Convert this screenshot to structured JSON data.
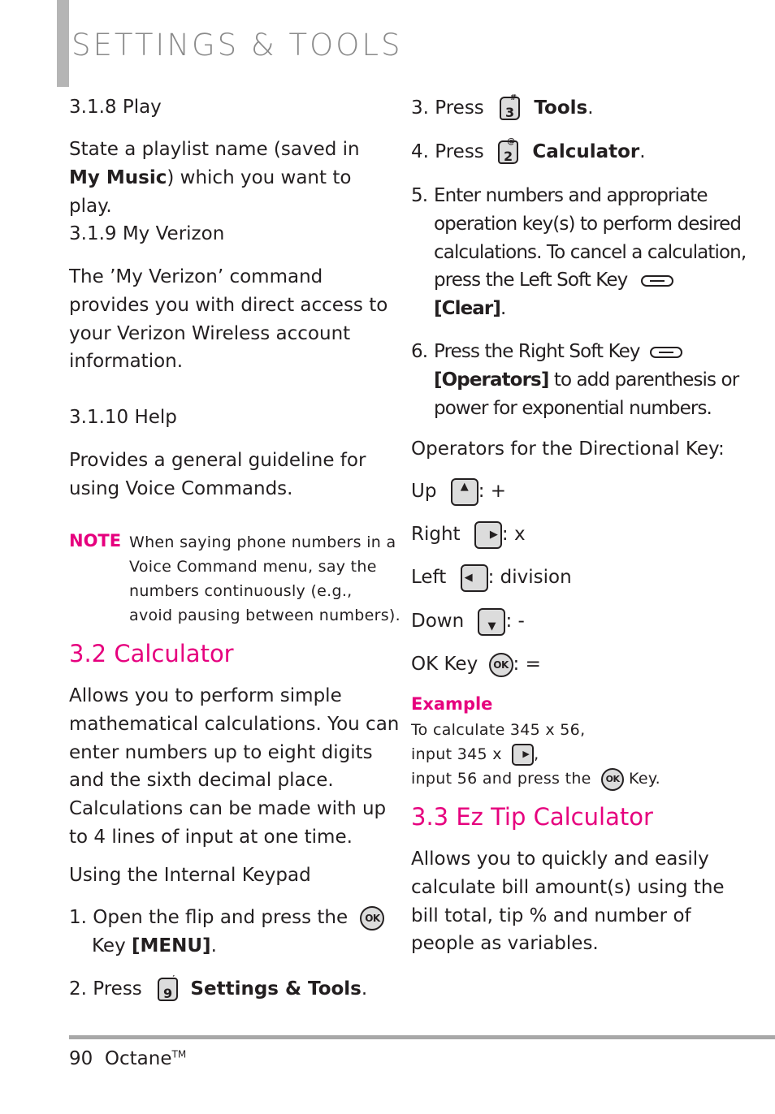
{
  "header": {
    "title": "SETTINGS & TOOLS"
  },
  "left": {
    "s318": {
      "heading": "3.1.8 Play",
      "text_pre": "State a playlist name (saved in ",
      "text_bold": "My Music",
      "text_post": ") which you want to play."
    },
    "s319": {
      "heading": "3.1.9 My Verizon",
      "lines": [
        "The ’My Verizon’ command",
        "provides you with direct access to",
        "your Verizon Wireless account",
        "information."
      ]
    },
    "s3110": {
      "heading": "3.1.10 Help",
      "lines": [
        "Provides a general guideline for",
        "using Voice Commands."
      ]
    },
    "note": {
      "label": "NOTE",
      "lines": [
        "When saying phone numbers in a",
        "Voice Command menu, say the",
        "numbers continuously (e.g.,",
        "avoid pausing between numbers)."
      ]
    },
    "calculator": {
      "heading": "3.2 Calculator",
      "lines": [
        "Allows you to perform simple",
        "mathematical calculations. You can",
        "enter numbers up to eight digits",
        "and the sixth decimal place.",
        "Calculations can be made with up",
        "to 4 lines of input at one time."
      ],
      "subheading": "Using the Internal Keypad",
      "step1": {
        "pre": "1. Open the flip and press the",
        "key": "OK",
        "line2_pre": "Key ",
        "line2_bold": "[MENU]",
        "line2_post": "."
      },
      "step2": {
        "pre": "2. Press",
        "key": "9",
        "key_sup": "′",
        "bold": "Settings & Tools",
        "post": "."
      }
    }
  },
  "right": {
    "step3": {
      "pre": "3. Press",
      "key": "3",
      "key_sup": "#",
      "bold": "Tools",
      "post": "."
    },
    "step4": {
      "pre": "4. Press",
      "key": "2",
      "key_sup": "@",
      "bold": "Calculator",
      "post": "."
    },
    "step5": {
      "num": "5.",
      "lines": [
        "Enter numbers and appropriate",
        "operation key(s) to perform desired",
        "calculations. To cancel a calculation,",
        "press the Left Soft Key"
      ],
      "bold": "[Clear]",
      "post": "."
    },
    "step6": {
      "num": "6.",
      "line1": "Press the Right Soft Key",
      "bold": "[Operators]",
      "line2_post": " to add parenthesis or",
      "line3": "power for exponential numbers."
    },
    "operators_intro": "Operators for the Directional Key:",
    "operators": [
      {
        "label": "Up",
        "icon": "▲",
        "op": ": +"
      },
      {
        "label": "Right",
        "icon": "▶",
        "op": ": x"
      },
      {
        "label": "Left",
        "icon": "◀",
        "op": ": division"
      },
      {
        "label": "Down",
        "icon": "▼",
        "op": ": -"
      },
      {
        "label": "OK Key",
        "icon": "OK",
        "op": ": ="
      }
    ],
    "example": {
      "label": "Example",
      "line1": "To calculate 345 x 56,",
      "line2_pre": "input 345 x",
      "line2_icon": "▶",
      "line2_post": ",",
      "line3_pre": "input 56 and press the",
      "line3_icon": "OK",
      "line3_post": "Key."
    },
    "tip": {
      "heading": "3.3 Ez Tip Calculator",
      "lines": [
        "Allows you to quickly and easily",
        "calculate bill amount(s) using the",
        "bill total, tip % and number of",
        "people as variables."
      ]
    }
  },
  "footer": {
    "page": "90",
    "product": "Octane",
    "tm": "TM"
  }
}
